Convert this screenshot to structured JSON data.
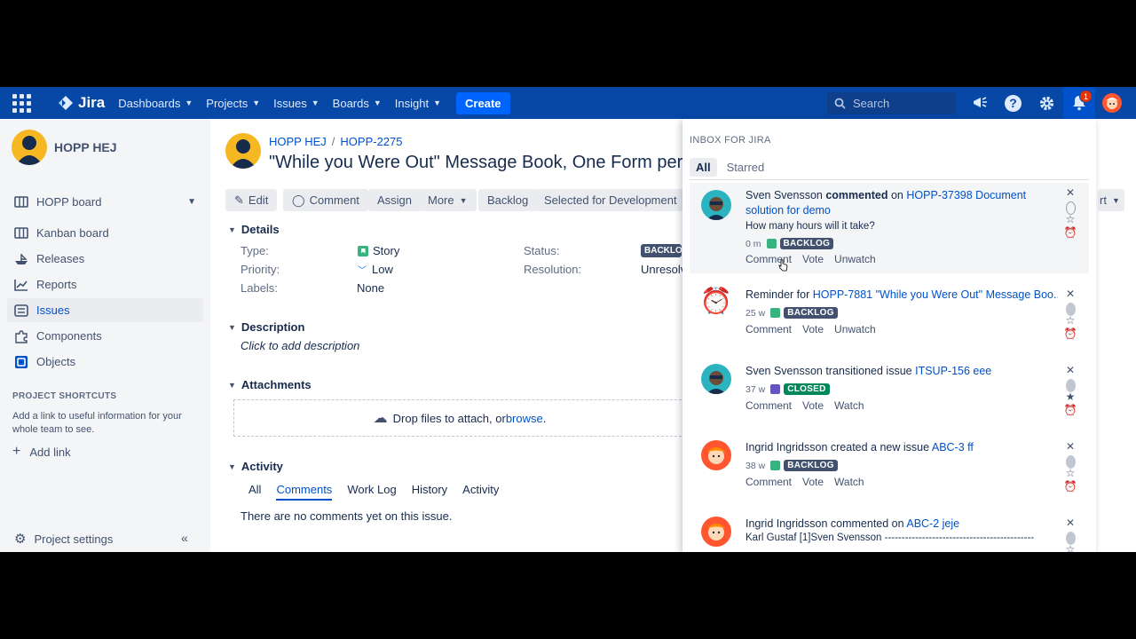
{
  "topnav": {
    "logo": "Jira",
    "items": [
      "Dashboards",
      "Projects",
      "Issues",
      "Boards",
      "Insight"
    ],
    "create": "Create",
    "search_placeholder": "Search",
    "notification_count": "1"
  },
  "sidebar": {
    "project_name": "HOPP HEJ",
    "items": [
      {
        "label": "HOPP board",
        "icon": "board-icon"
      },
      {
        "label": "Kanban board",
        "icon": "board-icon"
      },
      {
        "label": "Releases",
        "icon": "ship-icon"
      },
      {
        "label": "Reports",
        "icon": "chart-icon"
      },
      {
        "label": "Issues",
        "icon": "issues-icon"
      },
      {
        "label": "Components",
        "icon": "puzzle-icon"
      },
      {
        "label": "Objects",
        "icon": "objects-icon"
      }
    ],
    "shortcuts_heading": "PROJECT SHORTCUTS",
    "shortcuts_text": "Add a link to useful information for your whole team to see.",
    "add_link": "Add link",
    "project_settings": "Project settings"
  },
  "issue": {
    "breadcrumb_project": "HOPP HEJ",
    "breadcrumb_key": "HOPP-2275",
    "title": "\"While you Were Out\" Message Book, One Form per P",
    "buttons": {
      "edit": "Edit",
      "comment": "Comment",
      "assign": "Assign",
      "more": "More",
      "backlog": "Backlog",
      "selected": "Selected for Development",
      "right_cut": "rt"
    },
    "details_heading": "Details",
    "type_label": "Type:",
    "type_value": "Story",
    "priority_label": "Priority:",
    "priority_value": "Low",
    "labels_label": "Labels:",
    "labels_value": "None",
    "status_label": "Status:",
    "status_value": "BACKLOG",
    "resolution_label": "Resolution:",
    "resolution_value": "Unresolv",
    "description_heading": "Description",
    "description_placeholder": "Click to add description",
    "attachments_heading": "Attachments",
    "drop_text": "Drop files to attach, or ",
    "browse": "browse",
    "activity_heading": "Activity",
    "activity_tabs": [
      "All",
      "Comments",
      "Work Log",
      "History",
      "Activity"
    ],
    "no_comments": "There are no comments yet on this issue."
  },
  "inbox": {
    "heading": "INBOX FOR JIRA",
    "tab_all": "All",
    "tab_starred": "Starred",
    "notifications": [
      {
        "actor": "Sven Svensson",
        "verb": "commented",
        "pre": " on ",
        "link": "HOPP-37398 Document solution for demo",
        "sub": "How many hours will it take?",
        "age": "0 m",
        "status": "BACKLOG",
        "actions": [
          "Comment",
          "Vote",
          "Unwatch"
        ]
      },
      {
        "text": "Reminder for ",
        "link": "HOPP-7881 \"While you Were Out\" Message Boo...",
        "age": "25 w",
        "status": "BACKLOG",
        "actions": [
          "Comment",
          "Vote",
          "Unwatch"
        ]
      },
      {
        "text": "Sven Svensson transitioned issue ",
        "link": "ITSUP-156 eee",
        "age": "37 w",
        "status": "CLOSED",
        "actions": [
          "Comment",
          "Vote",
          "Watch"
        ]
      },
      {
        "text": "Ingrid Ingridsson created a new issue ",
        "link": "ABC-3 ff",
        "age": "38 w",
        "status": "BACKLOG",
        "actions": [
          "Comment",
          "Vote",
          "Watch"
        ]
      },
      {
        "text": "Ingrid Ingridsson commented on ",
        "link": "ABC-2 jeje",
        "sub": "Karl Gustaf [1]Sven Svensson --------------------------------------------"
      }
    ]
  }
}
